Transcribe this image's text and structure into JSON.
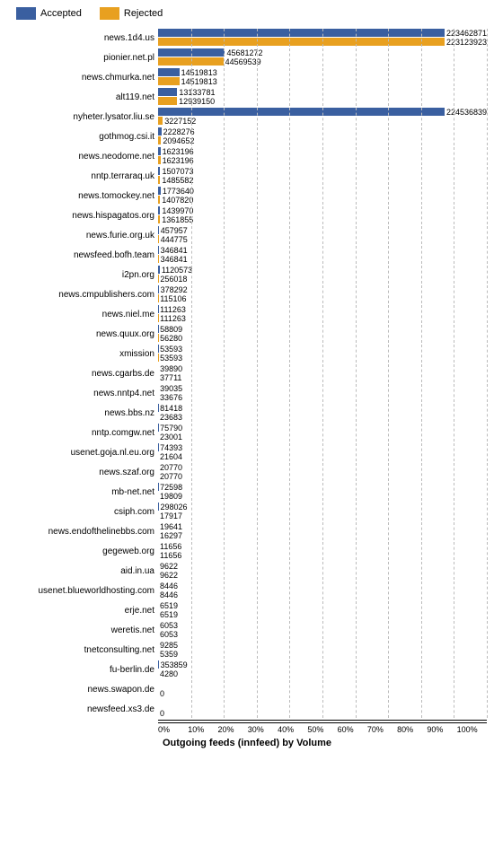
{
  "legend": {
    "accepted_label": "Accepted",
    "rejected_label": "Rejected"
  },
  "x_axis": {
    "label": "Outgoing feeds (innfeed) by Volume",
    "ticks": [
      "0%",
      "10%",
      "20%",
      "30%",
      "40%",
      "50%",
      "60%",
      "70%",
      "80%",
      "90%",
      "100%"
    ]
  },
  "rows": [
    {
      "label": "news.1d4.us",
      "accepted": 223462871,
      "rejected": 223123923,
      "a_pct": 100,
      "r_pct": 99.9
    },
    {
      "label": "pionier.net.pl",
      "accepted": 45681272,
      "rejected": 44569539,
      "a_pct": 20.4,
      "r_pct": 19.9
    },
    {
      "label": "news.chmurka.net",
      "accepted": 14519813,
      "rejected": 14519813,
      "a_pct": 6.5,
      "r_pct": 6.5
    },
    {
      "label": "alt119.net",
      "accepted": 13133781,
      "rejected": 12939150,
      "a_pct": 5.9,
      "r_pct": 5.8
    },
    {
      "label": "nyheter.lysator.liu.se",
      "accepted": 224536839,
      "rejected": 3227152,
      "a_pct": 100.5,
      "r_pct": 1.4
    },
    {
      "label": "gothmog.csi.it",
      "accepted": 2228276,
      "rejected": 2094652,
      "a_pct": 1.0,
      "r_pct": 0.94
    },
    {
      "label": "news.neodome.net",
      "accepted": 1623196,
      "rejected": 1623196,
      "a_pct": 0.73,
      "r_pct": 0.73
    },
    {
      "label": "nntp.terraraq.uk",
      "accepted": 1507073,
      "rejected": 1485582,
      "a_pct": 0.67,
      "r_pct": 0.66
    },
    {
      "label": "news.tomockey.net",
      "accepted": 1773640,
      "rejected": 1407820,
      "a_pct": 0.79,
      "r_pct": 0.63
    },
    {
      "label": "news.hispagatos.org",
      "accepted": 1439970,
      "rejected": 1361855,
      "a_pct": 0.64,
      "r_pct": 0.61
    },
    {
      "label": "news.furie.org.uk",
      "accepted": 457957,
      "rejected": 444775,
      "a_pct": 0.205,
      "r_pct": 0.199
    },
    {
      "label": "newsfeed.bofh.team",
      "accepted": 346841,
      "rejected": 346841,
      "a_pct": 0.155,
      "r_pct": 0.155
    },
    {
      "label": "i2pn.org",
      "accepted": 1120573,
      "rejected": 256018,
      "a_pct": 0.5,
      "r_pct": 0.115
    },
    {
      "label": "news.cmpublishers.com",
      "accepted": 378292,
      "rejected": 115106,
      "a_pct": 0.169,
      "r_pct": 0.052
    },
    {
      "label": "news.niel.me",
      "accepted": 111263,
      "rejected": 111263,
      "a_pct": 0.05,
      "r_pct": 0.05
    },
    {
      "label": "news.quux.org",
      "accepted": 58809,
      "rejected": 56280,
      "a_pct": 0.026,
      "r_pct": 0.025
    },
    {
      "label": "xmission",
      "accepted": 53593,
      "rejected": 53593,
      "a_pct": 0.024,
      "r_pct": 0.024
    },
    {
      "label": "news.cgarbs.de",
      "accepted": 39890,
      "rejected": 37711,
      "a_pct": 0.018,
      "r_pct": 0.017
    },
    {
      "label": "news.nntp4.net",
      "accepted": 39035,
      "rejected": 33676,
      "a_pct": 0.0175,
      "r_pct": 0.015
    },
    {
      "label": "news.bbs.nz",
      "accepted": 81418,
      "rejected": 23683,
      "a_pct": 0.036,
      "r_pct": 0.0106
    },
    {
      "label": "nntp.comgw.net",
      "accepted": 75790,
      "rejected": 23001,
      "a_pct": 0.034,
      "r_pct": 0.0103
    },
    {
      "label": "usenet.goja.nl.eu.org",
      "accepted": 74393,
      "rejected": 21604,
      "a_pct": 0.033,
      "r_pct": 0.0097
    },
    {
      "label": "news.szaf.org",
      "accepted": 20770,
      "rejected": 20770,
      "a_pct": 0.0093,
      "r_pct": 0.0093
    },
    {
      "label": "mb-net.net",
      "accepted": 72598,
      "rejected": 19809,
      "a_pct": 0.0325,
      "r_pct": 0.0089
    },
    {
      "label": "csiph.com",
      "accepted": 298026,
      "rejected": 17917,
      "a_pct": 0.133,
      "r_pct": 0.008
    },
    {
      "label": "news.endofthelinebbs.com",
      "accepted": 19641,
      "rejected": 16297,
      "a_pct": 0.0088,
      "r_pct": 0.0073
    },
    {
      "label": "gegeweb.org",
      "accepted": 11656,
      "rejected": 11656,
      "a_pct": 0.0052,
      "r_pct": 0.0052
    },
    {
      "label": "aid.in.ua",
      "accepted": 9622,
      "rejected": 9622,
      "a_pct": 0.0043,
      "r_pct": 0.0043
    },
    {
      "label": "usenet.blueworldhosting.com",
      "accepted": 8446,
      "rejected": 8446,
      "a_pct": 0.0038,
      "r_pct": 0.0038
    },
    {
      "label": "erje.net",
      "accepted": 6519,
      "rejected": 6519,
      "a_pct": 0.0029,
      "r_pct": 0.0029
    },
    {
      "label": "weretis.net",
      "accepted": 6053,
      "rejected": 6053,
      "a_pct": 0.0027,
      "r_pct": 0.0027
    },
    {
      "label": "tnetconsulting.net",
      "accepted": 9285,
      "rejected": 5359,
      "a_pct": 0.0042,
      "r_pct": 0.0024
    },
    {
      "label": "fu-berlin.de",
      "accepted": 353859,
      "rejected": 4280,
      "a_pct": 0.158,
      "r_pct": 0.0019
    },
    {
      "label": "news.swapon.de",
      "accepted": 0,
      "rejected": 0,
      "a_pct": 0,
      "r_pct": 0
    },
    {
      "label": "newsfeed.xs3.de",
      "accepted": 0,
      "rejected": 0,
      "a_pct": 0,
      "r_pct": 0
    }
  ],
  "chart": {
    "bar_area_width": 340,
    "max_value": 224536839
  }
}
